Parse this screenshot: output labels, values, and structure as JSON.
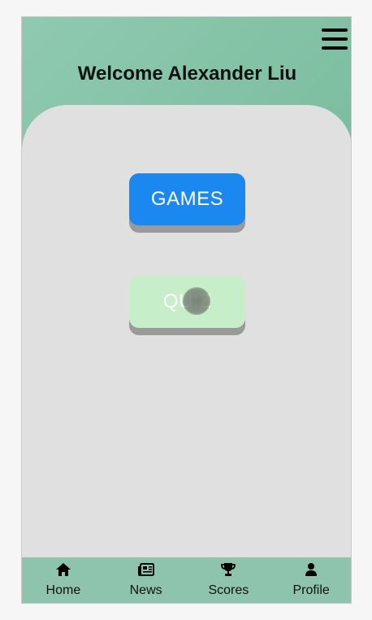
{
  "header": {
    "title": "Welcome Alexander Liu",
    "menu_icon": "hamburger-menu-icon"
  },
  "buttons": {
    "games_label": "GAMES",
    "quiz_label": "QUIZ"
  },
  "nav": {
    "items": [
      {
        "label": "Home",
        "icon": "home-icon"
      },
      {
        "label": "News",
        "icon": "newspaper-icon"
      },
      {
        "label": "Scores",
        "icon": "trophy-icon"
      },
      {
        "label": "Profile",
        "icon": "person-icon"
      }
    ]
  },
  "colors": {
    "header_gradient": "#7cbd9f",
    "panel": "#e0e0e0",
    "games_button": "#1a88ee",
    "quiz_button": "#c6efc9",
    "nav_bar": "#8ec3ad"
  }
}
